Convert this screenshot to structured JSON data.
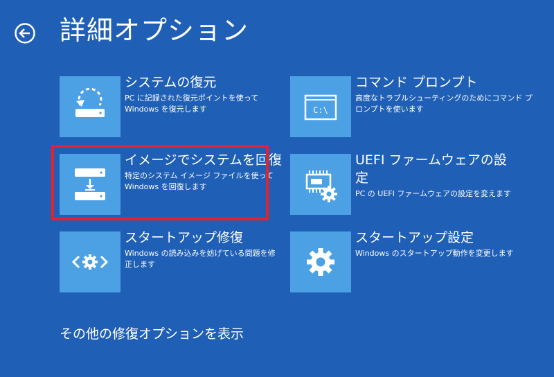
{
  "title": "詳細オプション",
  "options": [
    {
      "title": "システムの復元",
      "desc_lines": [
        "PC に記録された復元ポイントを使って",
        "Windows を復元します"
      ],
      "icon": "system-restore-icon"
    },
    {
      "title": "コマンド プロンプト",
      "desc_lines": [
        "高度なトラブルシューティングのためにコマンド プ",
        "ロンプトを使います"
      ],
      "icon": "command-prompt-icon",
      "icon_text": "C:\\"
    },
    {
      "title": "イメージでシステムを回復",
      "desc_lines": [
        "特定のシステム イメージ ファイルを使って",
        "Windows を回復します"
      ],
      "icon": "system-image-recovery-icon"
    },
    {
      "title_lines": [
        "UEFI ファームウェアの設",
        "定"
      ],
      "desc_lines": [
        "PC の UEFI ファームウェアの設定を変えます"
      ],
      "icon": "uefi-firmware-icon"
    },
    {
      "title": "スタートアップ修復",
      "desc_lines": [
        "Windows の読み込みを妨げている問題を修",
        "正します"
      ],
      "icon": "startup-repair-icon"
    },
    {
      "title": "スタートアップ設定",
      "desc_lines": [
        "Windows のスタートアップ動作を変更します"
      ],
      "icon": "startup-settings-icon"
    }
  ],
  "more_options_link": "その他の修復オプションを表示",
  "colors": {
    "background": "#1f5fb5",
    "tile": "#4ca0e4",
    "highlight": "#e6212b",
    "text": "#ffffff"
  }
}
